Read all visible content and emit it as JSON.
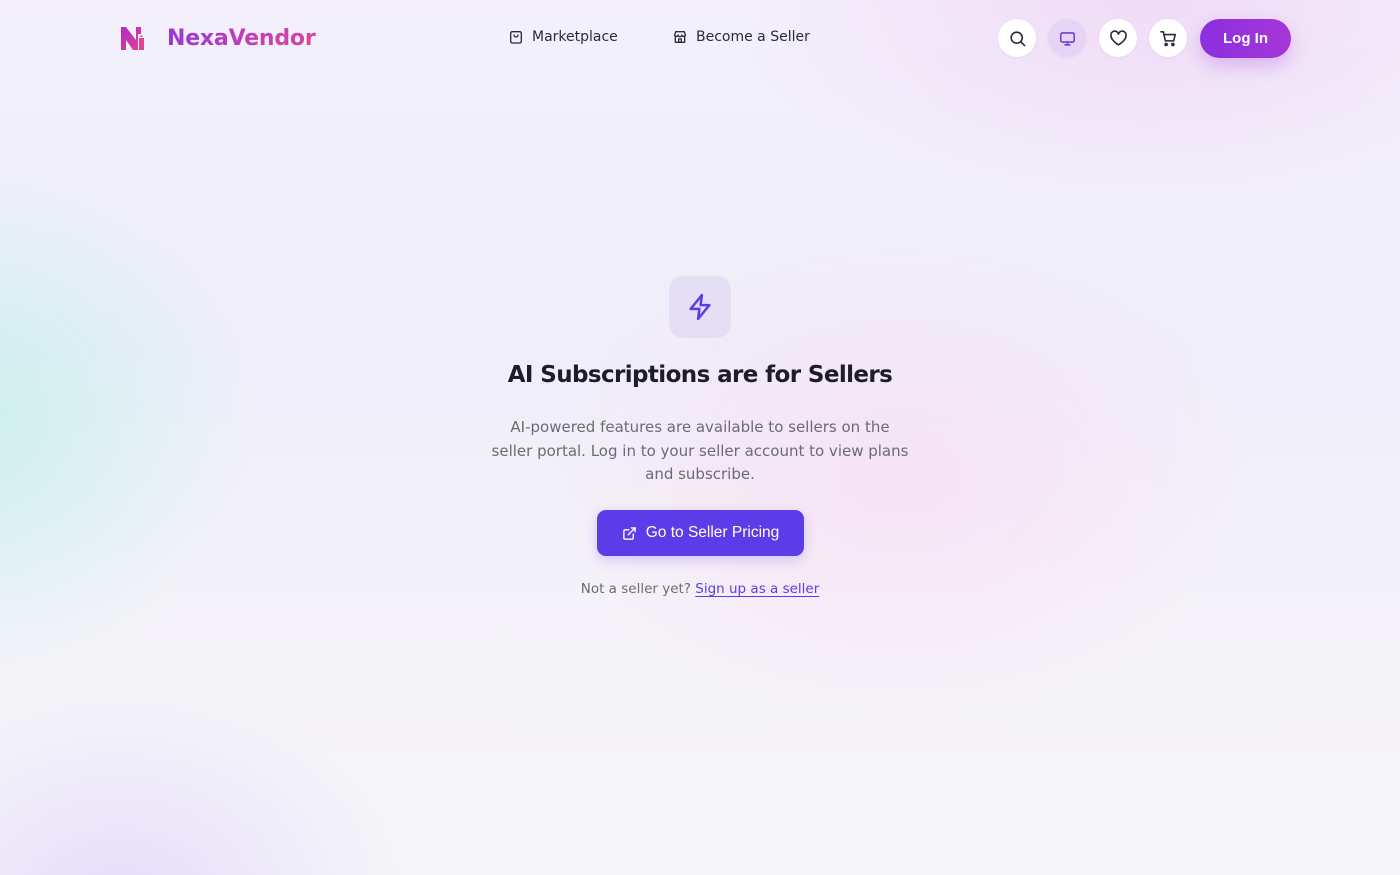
{
  "brand": {
    "name": "NexaVendor",
    "logo_icon": "nexavendor-logo-icon",
    "gradient": [
      "#9b36d6",
      "#d4489b"
    ]
  },
  "nav": {
    "links": [
      {
        "label": "Marketplace",
        "icon": "shopping-bag-icon"
      },
      {
        "label": "Become a Seller",
        "icon": "storefront-icon"
      }
    ]
  },
  "header_actions": {
    "icons": [
      "search-icon",
      "monitor-icon",
      "heart-icon",
      "cart-icon"
    ],
    "active_icon": "monitor-icon",
    "login_label": "Log In"
  },
  "main": {
    "icon": "lightning-bolt-icon",
    "title": "AI Subscriptions are for Sellers",
    "description": "AI-powered features are available to sellers on the seller portal. Log in to your seller account to view plans and subscribe.",
    "cta": {
      "label": "Go to Seller Pricing",
      "icon": "external-link-icon"
    },
    "signup_prompt": "Not a seller yet?",
    "signup_link": "Sign up as a seller"
  },
  "colors": {
    "accent": "#5b3ce8",
    "login_gradient": [
      "#8a2fe0",
      "#a636d8"
    ],
    "icon_tile": "#e4dff5"
  }
}
